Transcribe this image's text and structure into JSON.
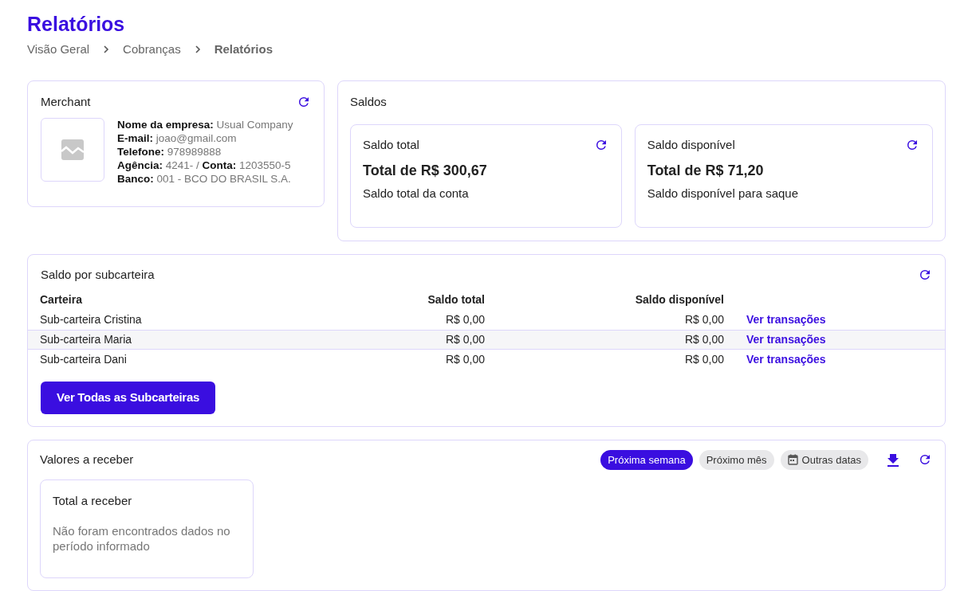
{
  "page": {
    "title": "Relatórios"
  },
  "breadcrumb": [
    {
      "label": "Visão Geral",
      "current": false
    },
    {
      "label": "Cobranças",
      "current": false
    },
    {
      "label": "Relatórios",
      "current": true
    }
  ],
  "merchant": {
    "title": "Merchant",
    "details": [
      "**Nome da empresa:** Usual Company",
      "**E-mail:** joao@gmail.com",
      "**Telefone:** 978989888",
      "**Agência:** 4241- / **Conta:** 1203550-5",
      "**Banco:** 001 - BCO DO BRASIL S.A."
    ]
  },
  "saldos": {
    "title": "Saldos",
    "cards": [
      {
        "title": "Saldo total",
        "amount": "Total de R$ 300,67",
        "description": "Saldo total da conta"
      },
      {
        "title": "Saldo disponível",
        "amount": "Total de R$ 71,20",
        "description": "Saldo disponível para saque"
      }
    ]
  },
  "subcarteiras": {
    "title": "Saldo por subcarteira",
    "columns": [
      "Carteira",
      "Saldo total",
      "Saldo disponível"
    ],
    "rows": [
      {
        "name": "Sub-carteira Cristina",
        "total": "R$ 0,00",
        "available": "R$ 0,00",
        "link": "Ver transações",
        "selected": false
      },
      {
        "name": "Sub-carteira Maria",
        "total": "R$ 0,00",
        "available": "R$ 0,00",
        "link": "Ver transações",
        "selected": true
      },
      {
        "name": "Sub-carteira Dani",
        "total": "R$ 0,00",
        "available": "R$ 0,00",
        "link": "Ver transações",
        "selected": false
      }
    ],
    "button": "Ver Todas as Subcarteiras"
  },
  "receber": {
    "title": "Valores a receber",
    "filters": [
      {
        "label": "Próxima semana",
        "kind": "preset",
        "selected": true
      },
      {
        "label": "Próximo mês",
        "kind": "preset",
        "selected": false
      },
      {
        "label": "Outras datas",
        "kind": "calendar",
        "selected": false
      }
    ],
    "card": {
      "title": "Total a receber",
      "message": "Não foram encontrados dados no período informado"
    }
  }
}
